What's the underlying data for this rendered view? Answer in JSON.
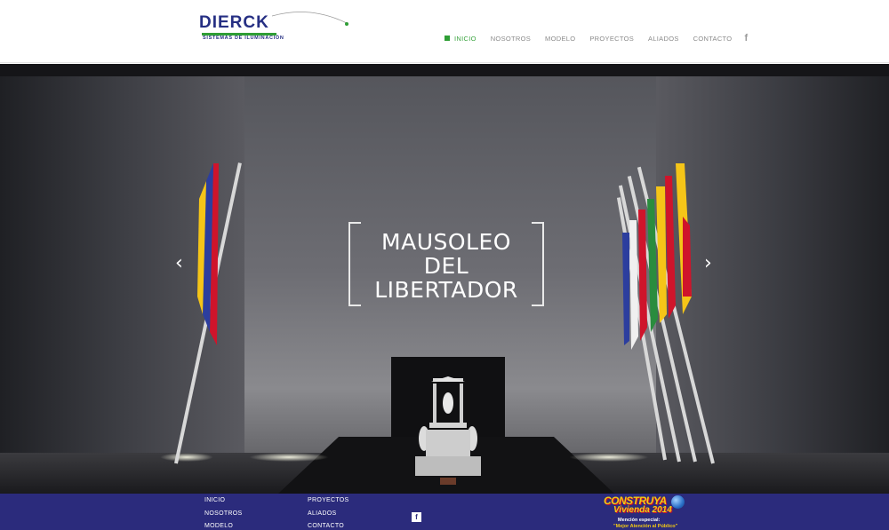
{
  "brand": {
    "name": "DIERCK",
    "tagline": "SISTEMAS DE ILUMINACIÓN",
    "colors": {
      "navy": "#262f83",
      "green": "#2f9e35",
      "footer": "#2b2b7c"
    }
  },
  "nav": {
    "items": [
      {
        "label": "INICIO",
        "active": true
      },
      {
        "label": "NOSOTROS"
      },
      {
        "label": "MODELO"
      },
      {
        "label": "PROYECTOS"
      },
      {
        "label": "ALIADOS"
      },
      {
        "label": "CONTACTO"
      }
    ],
    "social_icon": "facebook-icon",
    "social_glyph": "f"
  },
  "hero": {
    "title_lines": [
      "MAUSOLEO",
      "DEL",
      "LIBERTADOR"
    ],
    "prev_glyph": "‹",
    "next_glyph": "›",
    "prev_icon": "chevron-left-icon",
    "next_icon": "chevron-right-icon"
  },
  "footer": {
    "col1": [
      "INICIO",
      "NOSOTROS",
      "MODELO"
    ],
    "col2": [
      "PROYECTOS",
      "ALIADOS",
      "CONTACTO"
    ],
    "social_glyph": "f",
    "badge": {
      "line1": "CONSTRUYA",
      "line2": "Vivienda 2014",
      "line3": "Mención especial:",
      "line4": "\"Mejor Atención al Público\""
    }
  }
}
